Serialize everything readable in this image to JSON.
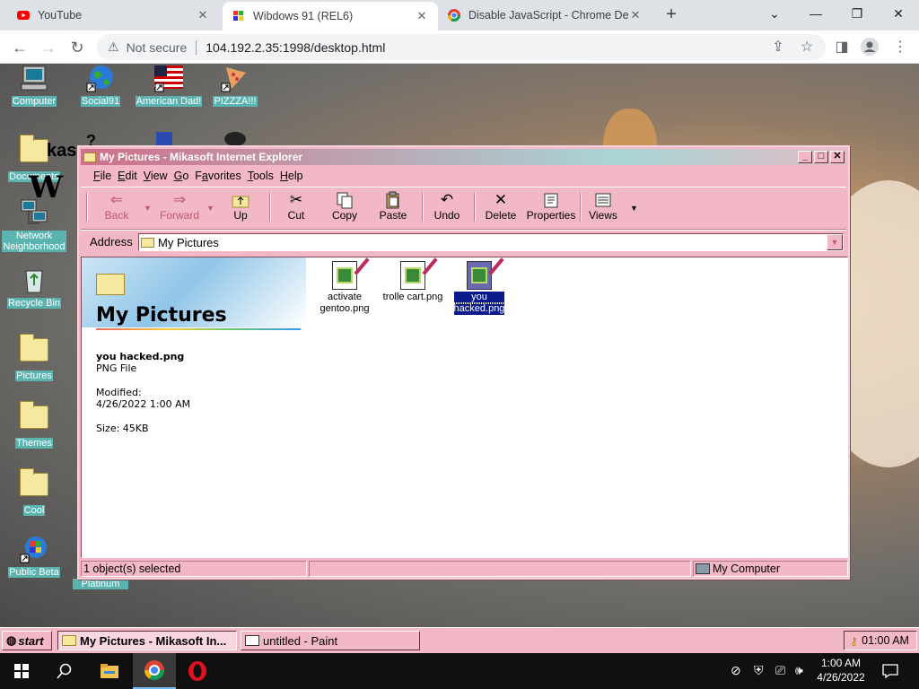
{
  "browser": {
    "tabs": [
      {
        "title": "YouTube",
        "close": "✕"
      },
      {
        "title": "Wibdows 91 (REL6)",
        "close": "✕"
      },
      {
        "title": "Disable JavaScript - Chrome Deve",
        "close": "✕"
      }
    ],
    "new_tab": "+",
    "window_controls": {
      "dropdown": "⌄",
      "minimize": "—",
      "restore": "❐",
      "close": "✕"
    },
    "security_label": "Not secure",
    "url": "104.192.2.35:1998/desktop.html"
  },
  "desktop": {
    "icons": [
      {
        "label": "Computer"
      },
      {
        "label": "Social91"
      },
      {
        "label": "American Dad!"
      },
      {
        "label": "PIZZZA!!!"
      },
      {
        "label": "Documents"
      },
      {
        "label": "Network Neighborhood"
      },
      {
        "label": "Recycle Bin"
      },
      {
        "label": "Pictures"
      },
      {
        "label": "Themes"
      },
      {
        "label": "Cool"
      },
      {
        "label": "Public Beta"
      },
      {
        "label": "Platinum"
      }
    ],
    "partial_text": "kas"
  },
  "explorer": {
    "title": "My Pictures - Mikasoft Internet Explorer",
    "menu": [
      "File",
      "Edit",
      "View",
      "Go",
      "Favorites",
      "Tools",
      "Help"
    ],
    "menu_access_keys": [
      "F",
      "E",
      "V",
      "G",
      "a",
      "T",
      "H"
    ],
    "toolbar": [
      {
        "label": "Back",
        "icon": "back-arrow"
      },
      {
        "label": "Forward",
        "icon": "forward-arrow"
      },
      {
        "label": "Up",
        "icon": "up-folder"
      },
      {
        "label": "Cut",
        "icon": "scissors"
      },
      {
        "label": "Copy",
        "icon": "copy-pages"
      },
      {
        "label": "Paste",
        "icon": "clipboard"
      },
      {
        "label": "Undo",
        "icon": "undo-arrow"
      },
      {
        "label": "Delete",
        "icon": "delete-x"
      },
      {
        "label": "Properties",
        "icon": "properties"
      },
      {
        "label": "Views",
        "icon": "views-grid"
      }
    ],
    "address_label": "Address",
    "address_value": "My Pictures",
    "folder_title": "My Pictures",
    "selected": {
      "name": "you hacked.png",
      "type": "PNG File",
      "modified_label": "Modified:",
      "modified_value": "4/26/2022 1:00 AM",
      "size": "Size: 45KB"
    },
    "files": [
      {
        "line1": "activate",
        "line2": "gentoo.png",
        "selected": false
      },
      {
        "line1": "trolle cart.png",
        "line2": "",
        "selected": false
      },
      {
        "line1": "you",
        "line2": "hacked.png",
        "selected": true
      }
    ],
    "status_left": "1 object(s) selected",
    "status_right": "My Computer"
  },
  "w95_taskbar": {
    "start": "start",
    "tasks": [
      "My Pictures - Mikasoft In...",
      "untitled - Paint"
    ],
    "clock": "01:00 AM"
  },
  "win10_taskbar": {
    "time": "1:00 AM",
    "date": "4/26/2022"
  },
  "colors": {
    "window_pink": "#f2b8c6",
    "title_gradient_start": "#cf6f8a",
    "title_gradient_end": "#a9d5d6",
    "desktop_label_teal": "#5bb3b0",
    "selection_blue": "#0a1a8a"
  }
}
